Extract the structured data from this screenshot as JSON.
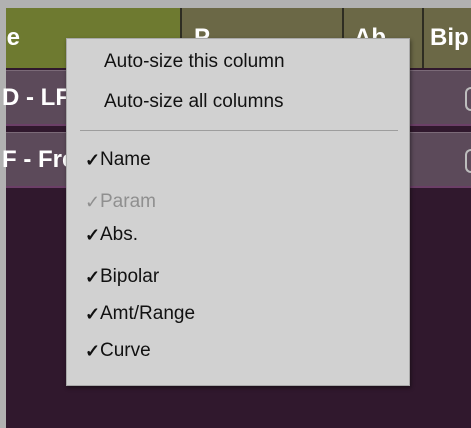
{
  "columns": {
    "name": "ne",
    "param": "P",
    "abs": "Ab",
    "bipolar": "Bip"
  },
  "rows": [
    {
      "name": "D - LF"
    },
    {
      "name": "F - Fre"
    }
  ],
  "context_menu": {
    "items": [
      {
        "label": "Auto-size this column"
      },
      {
        "label": "Auto-size all columns"
      }
    ],
    "column_toggles": [
      {
        "label": "Name",
        "checked": true,
        "enabled": true,
        "mark": "✓"
      },
      {
        "label": "Param",
        "checked": true,
        "enabled": false,
        "mark": "✓"
      },
      {
        "label": "Abs.",
        "checked": true,
        "enabled": true,
        "mark": "✓"
      },
      {
        "label": "Bipolar",
        "checked": true,
        "enabled": true,
        "mark": "✓"
      },
      {
        "label": "Amt/Range",
        "checked": true,
        "enabled": true,
        "mark": "✓"
      },
      {
        "label": "Curve",
        "checked": true,
        "enabled": true,
        "mark": "✓"
      }
    ]
  },
  "colors": {
    "header_name_bg": "#6e7a30",
    "header_bg": "#6b6846",
    "row_bg": "#5c4a5a",
    "panel_bg": "#30182d",
    "menu_bg": "#d1d1d1"
  }
}
